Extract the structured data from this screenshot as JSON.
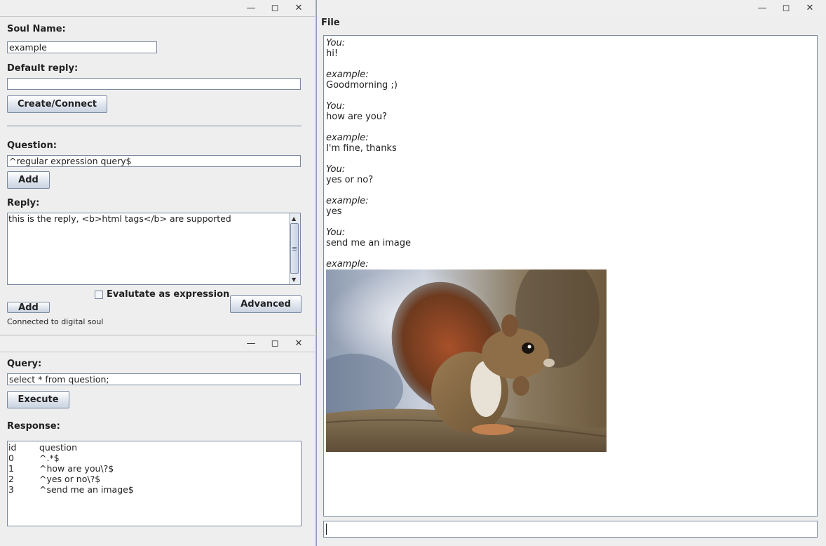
{
  "left_top_window": {
    "controls": [
      "—",
      "◻",
      "✕"
    ],
    "soul_name_label": "Soul Name:",
    "soul_name_value": "example",
    "default_reply_label": "Default reply:",
    "default_reply_value": "",
    "create_button": "Create/Connect",
    "question_label": "Question:",
    "question_value": "^regular expression query$",
    "add_question_button": "Add",
    "reply_label": "Reply:",
    "reply_value": "this is the reply, <b>html tags</b> are supported",
    "evaluate_label": "Evalutate as expression",
    "evaluate_checked": false,
    "add_reply_button": "Add",
    "advanced_button": "Advanced",
    "status": "Connected to digital soul"
  },
  "left_bottom_window": {
    "controls": [
      "—",
      "◻",
      "✕"
    ],
    "query_label": "Query:",
    "query_value": "select * from question;",
    "execute_button": "Execute",
    "response_label": "Response:",
    "response_columns": [
      "id",
      "question"
    ],
    "response_rows": [
      [
        "0",
        "^.*$"
      ],
      [
        "1",
        "^how are you\\?$"
      ],
      [
        "2",
        "^yes or no\\?$"
      ],
      [
        "3",
        "^send me an image$"
      ]
    ]
  },
  "chat_window": {
    "controls": [
      "—",
      "◻",
      "✕"
    ],
    "menu": [
      "File"
    ],
    "messages": [
      {
        "who": "You:",
        "text": "hi!"
      },
      {
        "who": "example:",
        "text": "Goodmorning ;)"
      },
      {
        "who": "You:",
        "text": "how are you?"
      },
      {
        "who": "example:",
        "text": "I'm fine, thanks"
      },
      {
        "who": "You:",
        "text": "yes or no?"
      },
      {
        "who": "example:",
        "text": "yes"
      },
      {
        "who": "You:",
        "text": "send me an image"
      },
      {
        "who": "example:",
        "image": "squirrel-image"
      }
    ],
    "input_value": ""
  }
}
